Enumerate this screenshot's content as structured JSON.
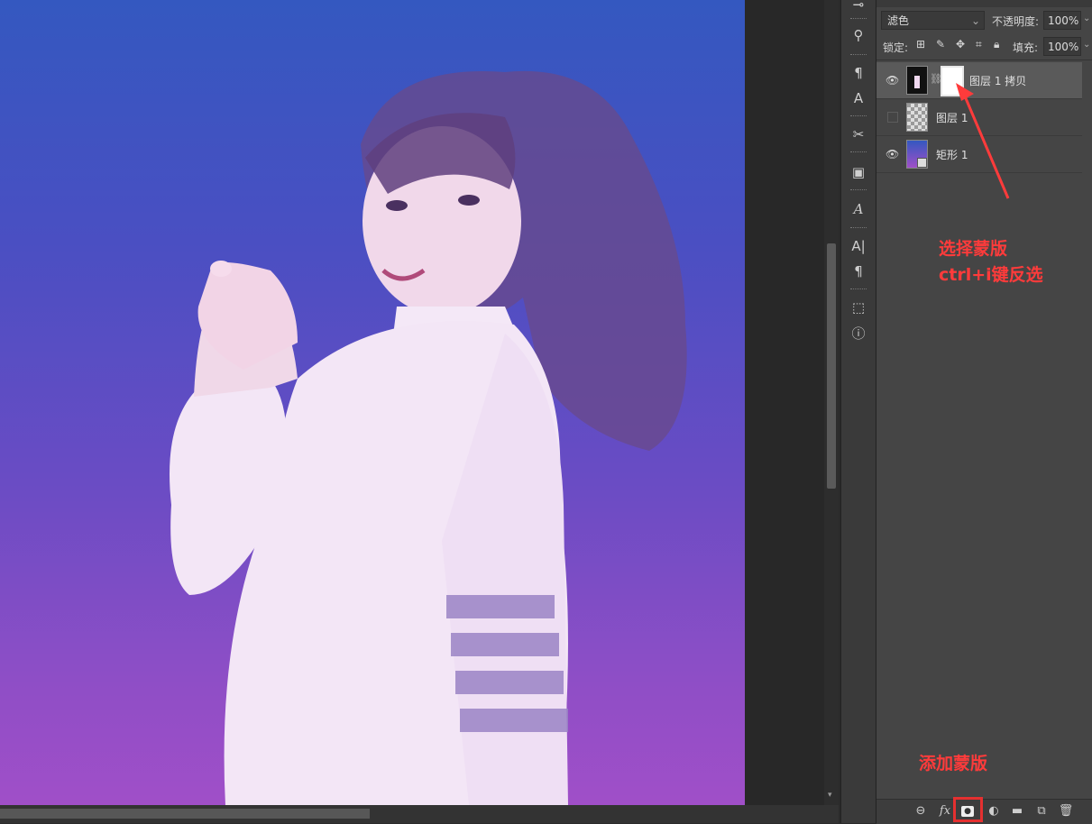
{
  "panel": {
    "blend_mode": "滤色",
    "opacity_label": "不透明度:",
    "opacity_value": "100%",
    "lock_label": "锁定:",
    "fill_label": "填充:",
    "fill_value": "100%"
  },
  "layers": [
    {
      "name": "图层 1 拷贝",
      "visible": true
    },
    {
      "name": "图层 1",
      "visible": false
    },
    {
      "name": "矩形 1",
      "visible": true
    }
  ],
  "annotations": {
    "select_mask": "选择蒙版",
    "invert_hint": "ctrl+i键反选",
    "add_mask": "添加蒙版"
  },
  "colors": {
    "annotation": "#ff3b3b",
    "canvas_top": "#3458c0",
    "canvas_bottom": "#a04fc8"
  }
}
